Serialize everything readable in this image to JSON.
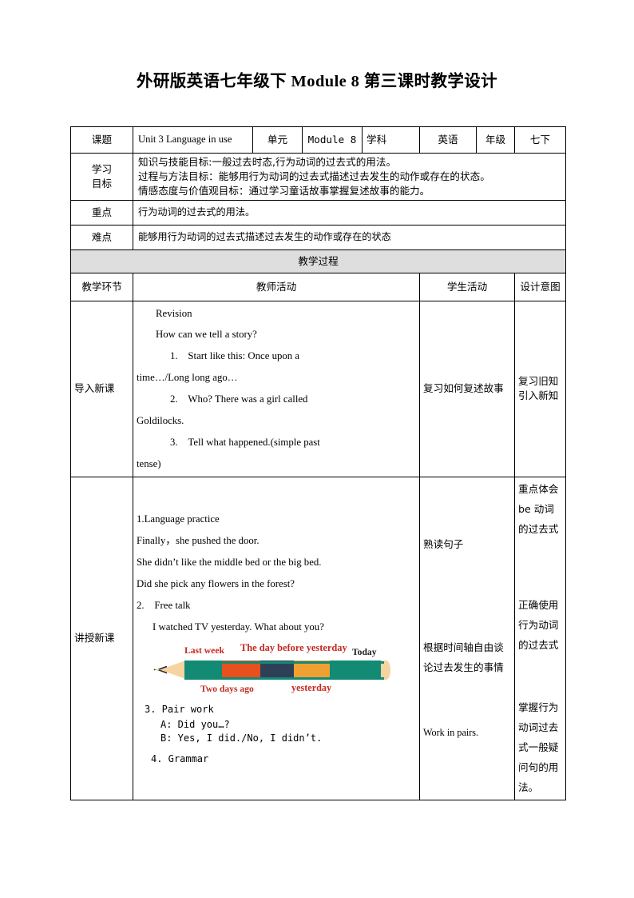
{
  "document": {
    "title": "外研版英语七年级下 Module 8 第三课时教学设计"
  },
  "info_table": {
    "topic_label": "课题",
    "topic_value": "Unit 3 Language in use",
    "unit_label": "单元",
    "unit_value": "Module 8",
    "subject_label": "学科",
    "subject_value": "英语",
    "grade_label": "年级",
    "grade_value": "七下"
  },
  "objectives": {
    "label_line1": "学习",
    "label_line2": "目标",
    "lines": [
      "知识与技能目标:一般过去时态,行为动词的过去式的用法。",
      "过程与方法目标：能够用行为动词的过去式描述过去发生的动作或存在的状态。",
      "情感态度与价值观目标：通过学习童话故事掌握复述故事的能力。"
    ]
  },
  "key_point": {
    "label": "重点",
    "value": "行为动词的过去式的用法。"
  },
  "difficult_point": {
    "label": "难点",
    "value": "能够用行为动词的过去式描述过去发生的动作或存在的状态"
  },
  "process": {
    "band_title": "教学过程",
    "columns": [
      "教学环节",
      "教师活动",
      "学生活动",
      "设计意图"
    ],
    "rows": [
      {
        "stage": "导入新课",
        "teacher": {
          "heading": "Revision",
          "question": "How can we tell a story?",
          "items": [
            "1. Start like this: Once upon a",
            "time…/Long long ago…",
            "2. Who? There was a girl called",
            "Goldilocks.",
            "3. Tell what happened.(simple past",
            "tense)"
          ]
        },
        "student": "复习如何复述故事",
        "intent": "复习旧知引入新知"
      },
      {
        "stage": "讲授新课",
        "teacher": {
          "part1_title": "1.Language practice",
          "sentences": [
            "Finally，she pushed the door.",
            "She didn’t like the middle bed or the big bed.",
            "Did she pick any flowers in the forest?"
          ],
          "part2_title": "2. Free talk",
          "free_talk_prompt": "I watched TV yesterday. What about you?",
          "part3_title": "3. Pair work",
          "dialogue": [
            "A: Did you…?",
            "B: Yes, I did./No, I didn’t."
          ],
          "part4_title": "4. Grammar"
        },
        "student_lines": [
          "熟读句子",
          "根据时间轴自由谈论过去发生的事情",
          "Work in pairs."
        ],
        "intent_lines": [
          "重点体会 be 动词的过去式",
          "正确使用行为动词的过去式",
          "掌握行为动词过去式一般疑问句的用法。"
        ]
      }
    ]
  },
  "timeline_figure": {
    "name": "pencil-timeline",
    "labels_above": [
      {
        "text": "Last week",
        "color": "#c42a22"
      },
      {
        "text": "The day before yesterday",
        "color": "#c42a22"
      },
      {
        "text": "Today",
        "color": "#1a1a1a"
      }
    ],
    "labels_below": [
      {
        "text": "Two days ago",
        "color": "#c42a22"
      },
      {
        "text": "yesterday",
        "color": "#c42a22"
      }
    ],
    "segment_colors": [
      "#128a74",
      "#e8501e",
      "#2e4057",
      "#efa032",
      "#128a74"
    ],
    "wood_color": "#f6d3a0",
    "lead_color": "#2f2f2f"
  },
  "colors": {
    "band_bg": "#dedede",
    "border": "#000000",
    "accent_red": "#c42a22"
  }
}
